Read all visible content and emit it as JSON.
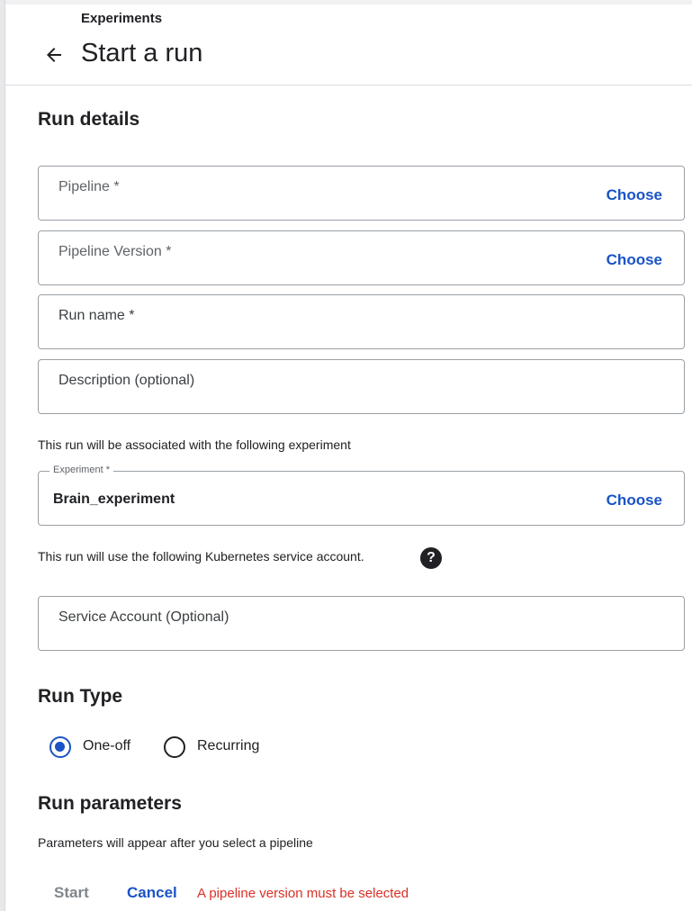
{
  "header": {
    "breadcrumb": "Experiments",
    "title": "Start a run"
  },
  "run_details": {
    "section_title": "Run details",
    "pipeline_label": "Pipeline *",
    "pipeline_version_label": "Pipeline Version *",
    "run_name_label": "Run name *",
    "description_label": "Description (optional)",
    "choose_label": "Choose"
  },
  "experiment": {
    "info_text": "This run will be associated with the following experiment",
    "field_label": "Experiment *",
    "value": "Brain_experiment",
    "choose_label": "Choose"
  },
  "service_account": {
    "info_text": "This run will use the following Kubernetes service account.",
    "help_glyph": "?",
    "field_label": "Service Account (Optional)"
  },
  "run_type": {
    "section_title": "Run Type",
    "options": [
      {
        "label": "One-off",
        "selected": true
      },
      {
        "label": "Recurring",
        "selected": false
      }
    ]
  },
  "run_parameters": {
    "section_title": "Run parameters",
    "info_text": "Parameters will appear after you select a pipeline"
  },
  "footer": {
    "start_label": "Start",
    "cancel_label": "Cancel",
    "error_message": "A pipeline version must be selected"
  },
  "colors": {
    "accent": "#1a53c5",
    "error": "#d93025",
    "disabled": "#80868b",
    "border": "#9aa0a6"
  },
  "icons": {
    "back": "arrow-back-icon",
    "help": "help-icon"
  }
}
